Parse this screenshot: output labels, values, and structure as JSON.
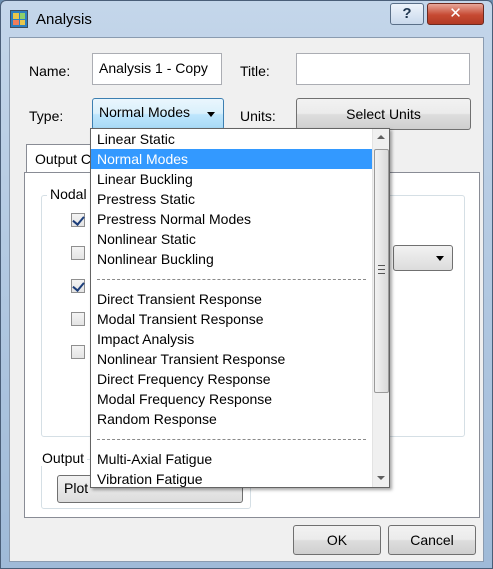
{
  "window": {
    "title": "Analysis",
    "help_glyph": "?",
    "close_glyph": "✕"
  },
  "form": {
    "name_label": "Name:",
    "name_value": "Analysis 1 - Copy",
    "title_label": "Title:",
    "title_value": "",
    "type_label": "Type:",
    "type_value": "Normal Modes",
    "units_label": "Units:",
    "select_units_button": "Select Units"
  },
  "tabs": [
    {
      "label": "Output C"
    }
  ],
  "nodal_group": {
    "title": "Nodal",
    "checkboxes": [
      {
        "checked": true
      },
      {
        "checked": false
      },
      {
        "checked": true
      },
      {
        "checked": false
      },
      {
        "checked": false
      }
    ]
  },
  "output_group": {
    "title": "Output",
    "combo_value": "Plot"
  },
  "type_dropdown": {
    "items": [
      {
        "label": "Linear Static",
        "selected": false
      },
      {
        "label": "Normal Modes",
        "selected": true
      },
      {
        "label": "Linear Buckling",
        "selected": false
      },
      {
        "label": "Prestress Static",
        "selected": false
      },
      {
        "label": "Prestress Normal Modes",
        "selected": false
      },
      {
        "label": "Nonlinear Static",
        "selected": false
      },
      {
        "label": "Nonlinear Buckling",
        "selected": false
      },
      {
        "separator": true
      },
      {
        "label": "Direct Transient Response",
        "selected": false
      },
      {
        "label": "Modal Transient Response",
        "selected": false
      },
      {
        "label": "Impact Analysis",
        "selected": false
      },
      {
        "label": "Nonlinear Transient Response",
        "selected": false
      },
      {
        "label": "Direct Frequency Response",
        "selected": false
      },
      {
        "label": "Modal Frequency Response",
        "selected": false
      },
      {
        "label": "Random Response",
        "selected": false
      },
      {
        "separator": true
      },
      {
        "label": "Multi-Axial Fatigue",
        "selected": false
      },
      {
        "label": "Vibration Fatigue",
        "selected": false
      }
    ]
  },
  "footer": {
    "ok_button": "OK",
    "cancel_button": "Cancel"
  },
  "colors": {
    "selection": "#3399ff",
    "title_bar": "#b3cae3",
    "close_button": "#c64a33"
  }
}
